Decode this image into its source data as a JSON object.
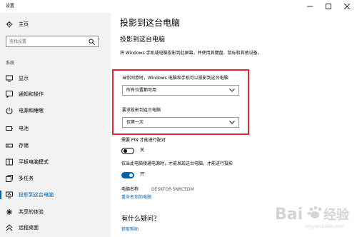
{
  "window": {
    "title": "设置",
    "buttons": [
      "minimize-icon",
      "maximize-icon",
      "close-icon"
    ]
  },
  "sidebar": {
    "home_label": "主页",
    "search_placeholder": "查找设置",
    "section_label": "系统",
    "items": [
      {
        "label": "显示",
        "icon": "display-icon"
      },
      {
        "label": "通知和操作",
        "icon": "notifications-icon"
      },
      {
        "label": "电源和睡眠",
        "icon": "power-icon"
      },
      {
        "label": "电池",
        "icon": "battery-icon"
      },
      {
        "label": "存储",
        "icon": "storage-icon"
      },
      {
        "label": "平板电脑模式",
        "icon": "tablet-mode-icon"
      },
      {
        "label": "多任务",
        "icon": "multitasking-icon"
      },
      {
        "label": "投影到这台电脑",
        "icon": "projecting-icon",
        "active": true
      },
      {
        "label": "共享的体验",
        "icon": "shared-experiences-icon"
      },
      {
        "label": "远程桌面",
        "icon": "remote-desktop-icon"
      }
    ]
  },
  "main": {
    "title": "投影到这台电脑",
    "section_title": "投影到这台电脑",
    "description": "将 Windows 手机或电脑投影到此屏幕，并使用其键盘、鼠标和其他设备。",
    "availability": {
      "label": "当你同意时，Windows 电脑和手机可以投影到这台电脑",
      "value": "所有位置都可用"
    },
    "ask_projection": {
      "label": "要求投影到这台电脑",
      "value": "仅第一次"
    },
    "pin": {
      "label": "需要 PIN 才能进行配对",
      "state_text": "关",
      "on": false
    },
    "plugged_in": {
      "label": "仅当此电脑接通电源时，才能发现这台电脑，才能进行投影",
      "state_text": "开",
      "on": true
    },
    "pc_name": {
      "label": "电脑名称",
      "value": "DESKTOP-5NRCEDM",
      "rename_link": "重命名你的电脑"
    },
    "faq": {
      "title": "有什么疑问？",
      "help_link": "获取帮助"
    }
  },
  "colors": {
    "accent": "#0063b1",
    "highlight_border": "#e32a2a",
    "sidebar_bg": "#f2f2f2"
  },
  "watermark": {
    "text": "Bai经验",
    "subtext": "jingyan.baidu.com"
  }
}
